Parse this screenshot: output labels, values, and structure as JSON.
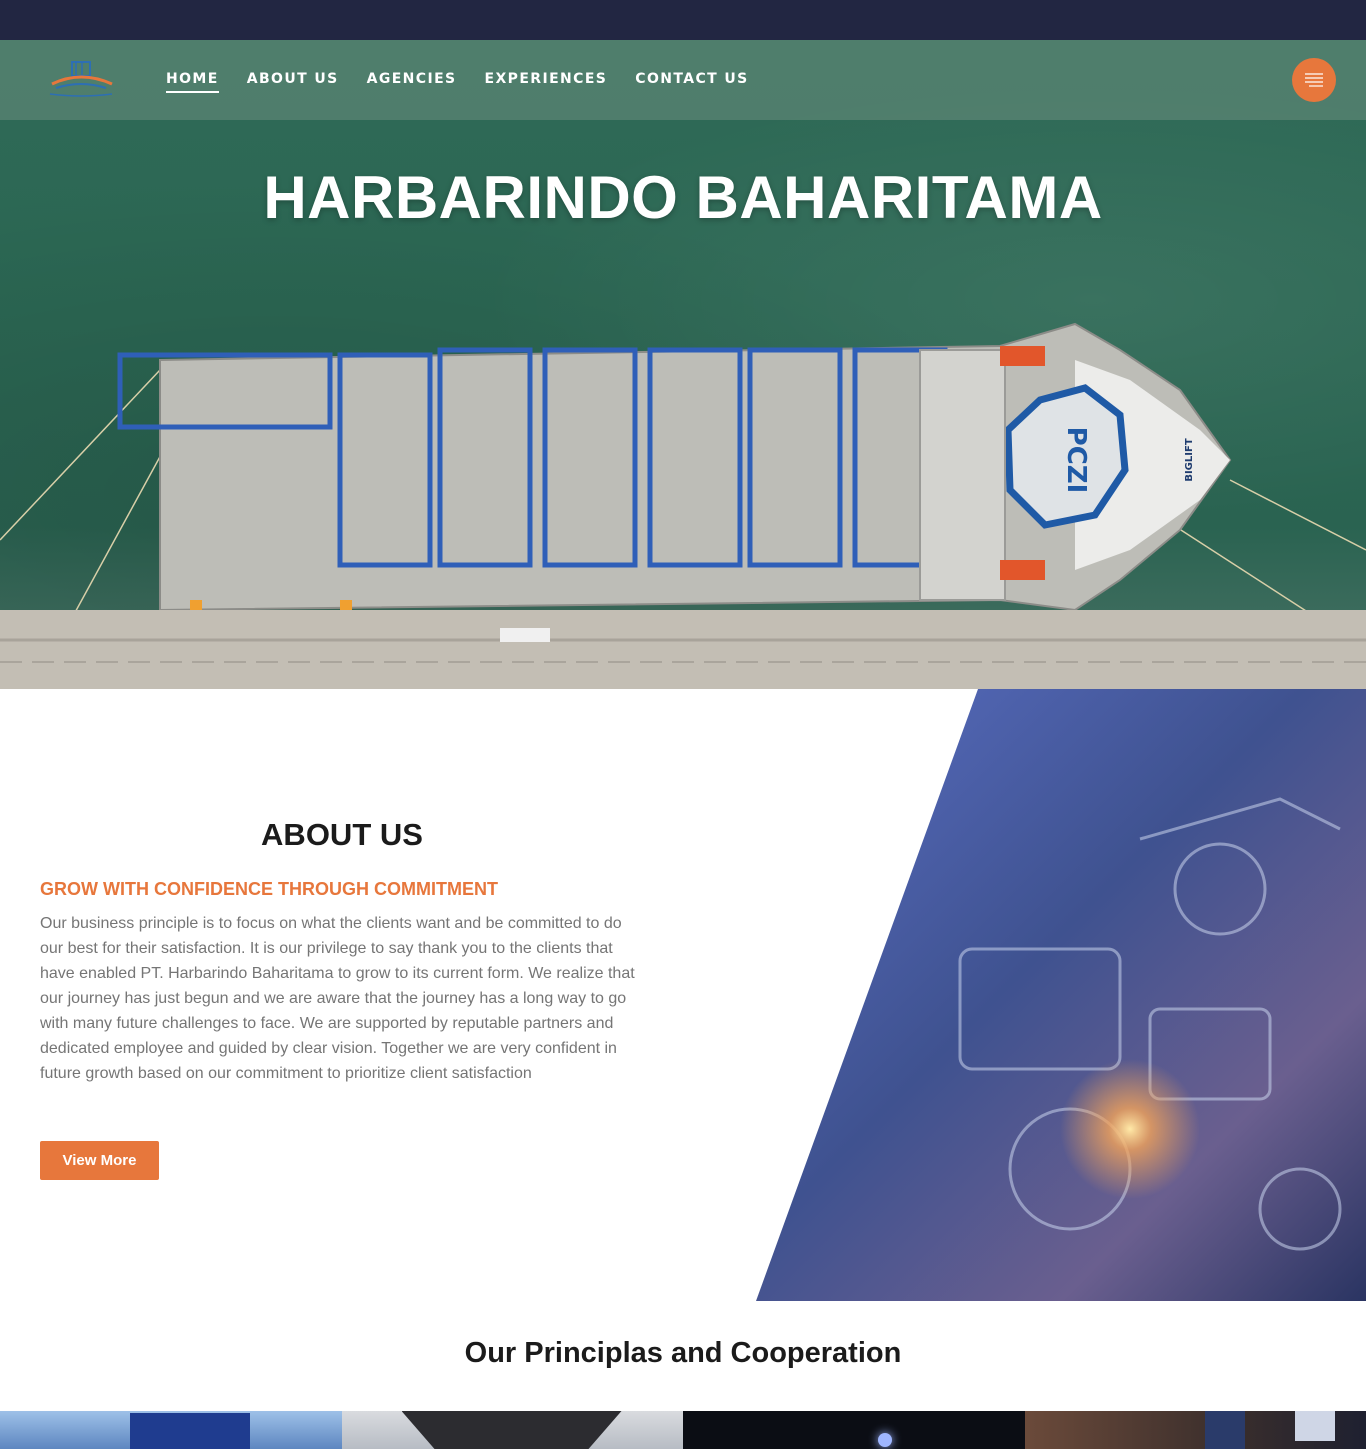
{
  "nav": {
    "items": [
      {
        "label": "HOME",
        "active": true
      },
      {
        "label": "ABOUT US",
        "active": false
      },
      {
        "label": "AGENCIES",
        "active": false
      },
      {
        "label": "EXPERIENCES",
        "active": false
      },
      {
        "label": "CONTACT US",
        "active": false
      }
    ],
    "menu_icon": "hamburger-icon"
  },
  "hero": {
    "title": "HARBARINDO BAHARITAMA",
    "ship_deck_text": "PCZI",
    "ship_bow_text": "BIGLIFT"
  },
  "about": {
    "title": "ABOUT US",
    "subtitle": "GROW WITH CONFIDENCE THROUGH COMMITMENT",
    "body": "Our business principle is to focus on what the clients want and be committed to do our best for their satisfaction. It is our privilege to say thank you to the clients that have enabled PT. Harbarindo Baharitama to grow to its current form. We realize that our journey has just begun and we are aware that the journey has a long way to go with many future challenges to face. We are supported by reputable partners and dedicated employee and guided by clear vision. Together we are very confident in future growth based on our commitment to prioritize client satisfaction",
    "button_label": "View More"
  },
  "principals": {
    "title": "Our Principlas and Cooperation"
  },
  "colors": {
    "accent": "#e7773c",
    "topbar": "#222642",
    "heading": "#1b1b1b",
    "body_text": "#757575"
  }
}
